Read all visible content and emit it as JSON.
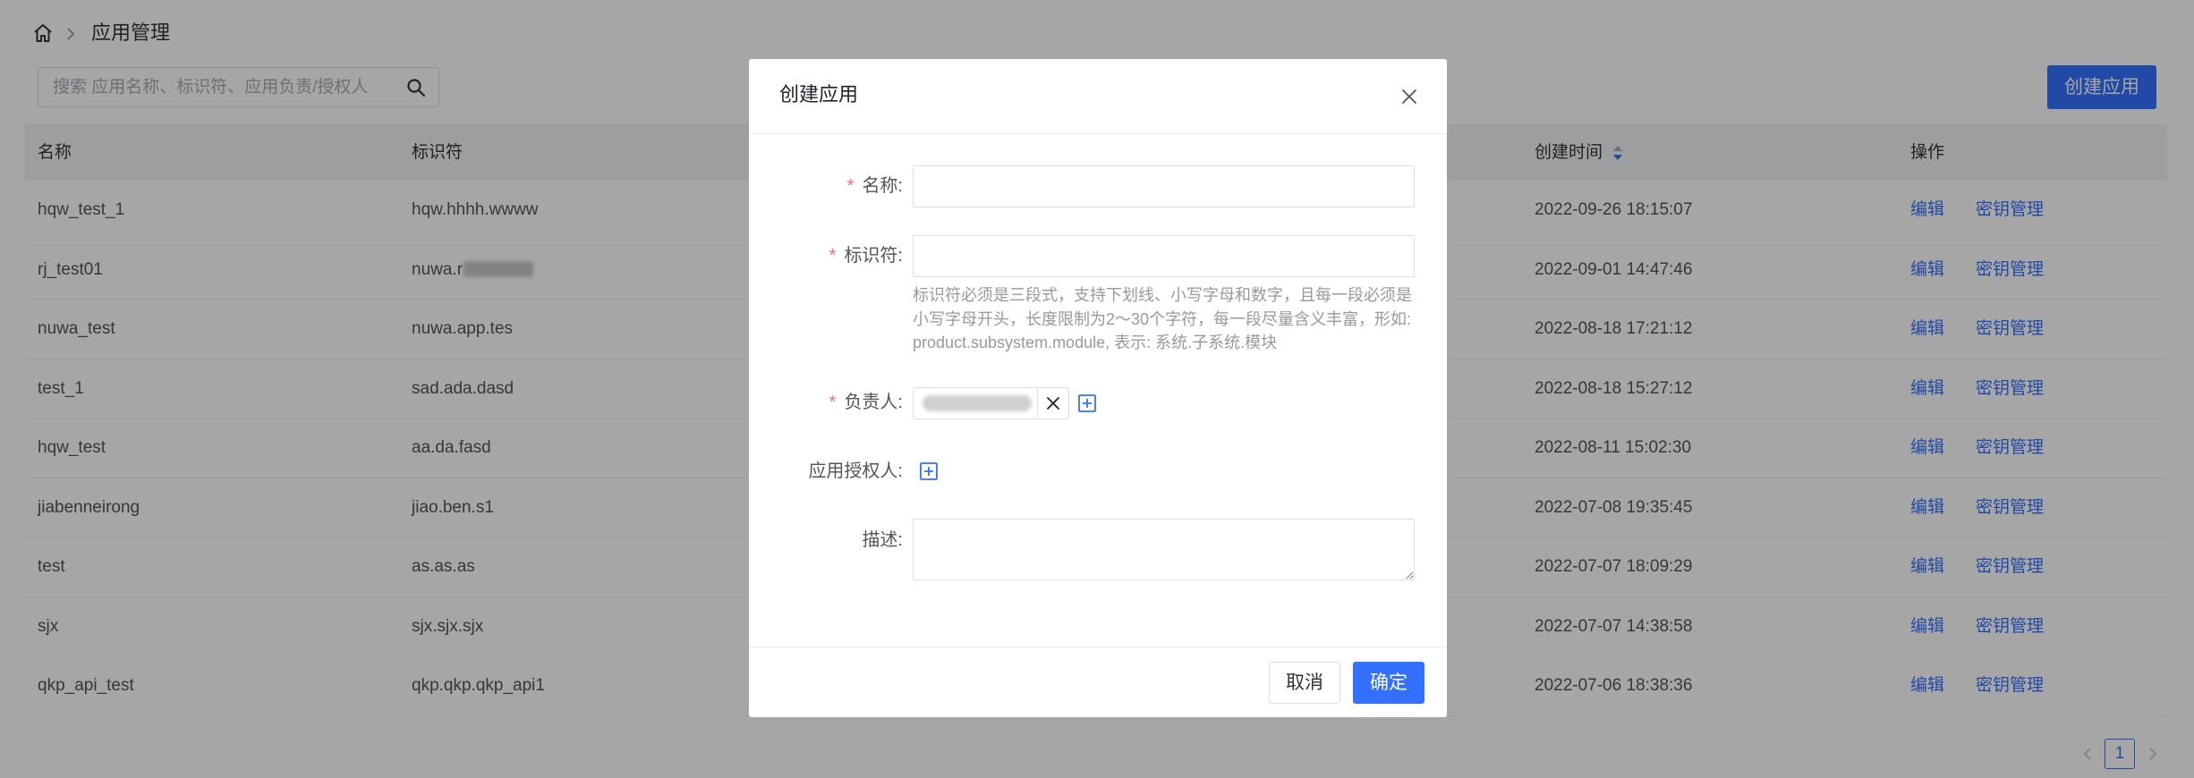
{
  "breadcrumb": {
    "current": "应用管理"
  },
  "search": {
    "placeholder": "搜索 应用名称、标识符、应用负责/授权人"
  },
  "toolbar": {
    "create_label": "创建应用"
  },
  "table": {
    "columns": {
      "name": "名称",
      "identifier": "标识符",
      "created": "创建时间",
      "actions": "操作"
    },
    "rows": [
      {
        "name": "hqw_test_1",
        "identifier": "hqw.hhhh.wwww",
        "created": "2022-09-26 18:15:07"
      },
      {
        "name": "rj_test01",
        "identifier": "nuwa.r",
        "redacted": true,
        "created": "2022-09-01 14:47:46"
      },
      {
        "name": "nuwa_test",
        "identifier": "nuwa.app.tes",
        "created": "2022-08-18 17:21:12"
      },
      {
        "name": "test_1",
        "identifier": "sad.ada.dasd",
        "created": "2022-08-18 15:27:12"
      },
      {
        "name": "hqw_test",
        "identifier": "aa.da.fasd",
        "created": "2022-08-11 15:02:30"
      },
      {
        "name": "jiabenneirong",
        "identifier": "jiao.ben.s1",
        "created": "2022-07-08 19:35:45"
      },
      {
        "name": "test",
        "identifier": "as.as.as",
        "created": "2022-07-07 18:09:29"
      },
      {
        "name": "sjx",
        "identifier": "sjx.sjx.sjx",
        "created": "2022-07-07 14:38:58"
      },
      {
        "name": "qkp_api_test",
        "identifier": "qkp.qkp.qkp_api1",
        "created": "2022-07-06 18:38:36"
      }
    ],
    "actions": {
      "edit": "编辑",
      "keys": "密钥管理"
    }
  },
  "pagination": {
    "current_page": "1"
  },
  "modal": {
    "title": "创建应用",
    "required_mark": "*",
    "fields": {
      "name_label": "名称:",
      "identifier_label": "标识符:",
      "identifier_help": [
        "标识符必须是三段式，支持下划线、小写字母和数字，且每一段必须是",
        "小写字母开头，长度限制为2～30个字符，每一段尽量含义丰富，形如:",
        "product.subsystem.module, 表示: 系统.子系统.模块"
      ],
      "owner_label": "负责人:",
      "authorized_label": "应用授权人:",
      "description_label": "描述:"
    },
    "cancel_label": "取消",
    "confirm_label": "确定"
  },
  "colors": {
    "primary": "#3370ff",
    "required": "#f56c6c",
    "mask": "rgba(0,0,0,0.35)"
  },
  "icons": [
    "home-icon",
    "chevron-right-icon",
    "search-icon",
    "sort-icon",
    "close-icon",
    "add-square-icon",
    "chevron-left-icon"
  ]
}
